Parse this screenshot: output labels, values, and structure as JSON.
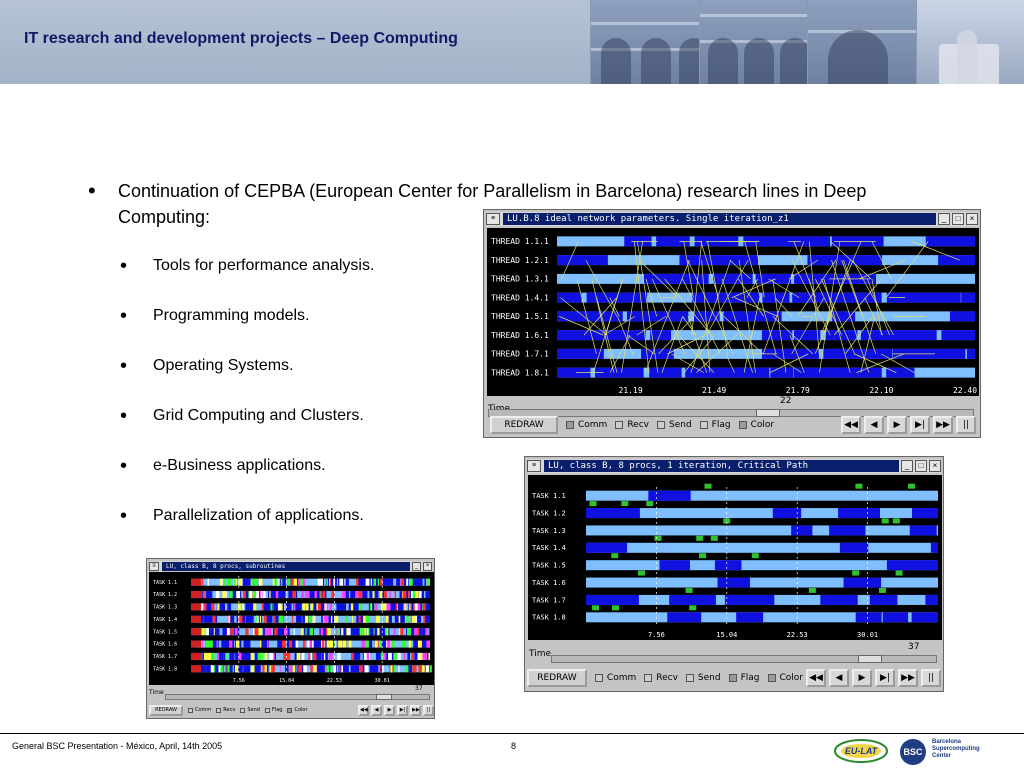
{
  "header": {
    "title": "IT research and development projects – Deep Computing"
  },
  "bullets": {
    "main": "Continuation of CEPBA (European Center for Parallelism in Barcelona) research lines in Deep Computing:",
    "items": [
      "Tools for performance analysis.",
      "Programming models.",
      "Operating Systems.",
      "Grid Computing and Clusters.",
      "e-Business applications.",
      "Parallelization of applications."
    ]
  },
  "window1": {
    "title": "LU.B.8 ideal network parameters. Single iteration_z1",
    "rows": [
      "THREAD 1.1.1",
      "THREAD 1.2.1",
      "THREAD 1.3.1",
      "THREAD 1.4.1",
      "THREAD 1.5.1",
      "THREAD 1.6.1",
      "THREAD 1.7.1",
      "THREAD 1.8.1"
    ],
    "ticks": [
      "21.19",
      "21.49",
      "21.79",
      "22.10",
      "22.40"
    ],
    "time_label": "Time",
    "time_value": "22",
    "slider_level": 0.58,
    "redraw": "REDRAW",
    "options": [
      {
        "label": "Comm",
        "checked": true
      },
      {
        "label": "Recv",
        "checked": false
      },
      {
        "label": "Send",
        "checked": false
      },
      {
        "label": "Flag",
        "checked": false
      },
      {
        "label": "Color",
        "checked": true
      }
    ]
  },
  "window2": {
    "title": "LU, class B, 8 procs, 1 iteration, Critical Path",
    "rows": [
      "TASK 1.1",
      "TASK 1.2",
      "TASK 1.3",
      "TASK 1.4",
      "TASK 1.5",
      "TASK 1.6",
      "TASK 1.7",
      "TASK 1.8"
    ],
    "ticks": [
      "7.56",
      "15.04",
      "22.53",
      "30.01"
    ],
    "time_label": "Time",
    "time_value": "37",
    "slider_level": 0.85,
    "redraw": "REDRAW",
    "options": [
      {
        "label": "Comm",
        "checked": false
      },
      {
        "label": "Recv",
        "checked": false
      },
      {
        "label": "Send",
        "checked": false
      },
      {
        "label": "Flag",
        "checked": true
      },
      {
        "label": "Color",
        "checked": true
      }
    ]
  },
  "window3": {
    "title": "LU, class B, 8 procs, subroutines",
    "rows": [
      "TASK 1.1",
      "TASK 1.2",
      "TASK 1.3",
      "TASK 1.4",
      "TASK 1.5",
      "TASK 1.6",
      "TASK 1.7",
      "TASK 1.8"
    ],
    "ticks": [
      "7.56",
      "15.04",
      "22.53",
      "30.01"
    ],
    "time_label": "Time",
    "time_value": "37",
    "slider_level": 0.85,
    "redraw": "REDRAW",
    "options": [
      {
        "label": "Comm",
        "checked": false
      },
      {
        "label": "Recv",
        "checked": false
      },
      {
        "label": "Send",
        "checked": false
      },
      {
        "label": "Flag",
        "checked": false
      },
      {
        "label": "Color",
        "checked": true
      }
    ]
  },
  "nav_icons": [
    "fast-rewind-icon",
    "rewind-icon",
    "play-icon",
    "step-forward-icon",
    "fast-forward-icon",
    "pause-icon"
  ],
  "colors": {
    "header_title": "#0d1a66",
    "trace_blue": "#1010e0",
    "trace_light": "#7fbfff",
    "trace_bg": "#000000",
    "comm_line": "#e0e070",
    "flag_green": "#30c030",
    "titlebar": "#0a1f6b"
  },
  "footer": {
    "text": "General BSC Presentation - México, April, 14th 2005",
    "page": "8",
    "logo_eulat": "EU-LAT",
    "logo_bsc": "BSC",
    "bsc_name": "Barcelona Supercomputing Center"
  }
}
